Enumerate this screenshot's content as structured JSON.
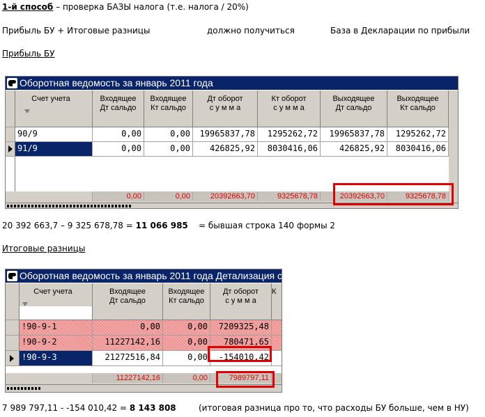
{
  "heading": {
    "method": "1-й способ",
    "rest": " – проверка БАЗЫ налога  (т.е. налога / 20%)"
  },
  "formula_row": {
    "left": "Прибыль БУ   +  Итоговые разницы",
    "middle": "должно получиться",
    "right": "База в  Декларации по прибыли"
  },
  "section1_label": "Прибыль БУ",
  "window1": {
    "title": "Оборотная ведомость за январь 2011 года",
    "headers": [
      [
        "Счет учета",
        ""
      ],
      [
        "Входящее",
        "Дт сальдо"
      ],
      [
        "Входящее",
        "Кт сальдо"
      ],
      [
        "Дт оборот",
        "с у м м а"
      ],
      [
        "Кт оборот",
        "с у м м а"
      ],
      [
        "Выходящее",
        "Дт сальдо"
      ],
      [
        "Выходящее",
        "Кт сальдо"
      ]
    ],
    "rows": [
      [
        "90/9",
        "0,00",
        "0,00",
        "19965837,78",
        "1295262,72",
        "19965837,78",
        "1295262,72"
      ],
      [
        "91/9",
        "0,00",
        "0,00",
        "426825,92",
        "8030416,06",
        "426825,92",
        "8030416,06"
      ]
    ],
    "totals": [
      "0,00",
      "0,00",
      "20392663,70",
      "9325678,78",
      "20392663,70",
      "9325678,78"
    ]
  },
  "calc1": {
    "expr": "20 392 663,7 – 9 325 678,78 = ",
    "result": "11 066 985",
    "note": "= бывшая строка 140  формы 2"
  },
  "section2_label": "Итоговые  разницы",
  "window2": {
    "title": "Оборотная ведомость за январь 2011 года Детализация с",
    "headers": [
      [
        "Счет учета",
        ""
      ],
      [
        "Входящее",
        "Дт сальдо"
      ],
      [
        "Входящее",
        "Кт сальдо"
      ],
      [
        "Дт оборот",
        "с у м м а"
      ],
      [
        "К",
        ""
      ]
    ],
    "rows": [
      [
        "!90-9-1",
        "0,00",
        "0,00",
        "7209325,48"
      ],
      [
        "!90-9-2",
        "11227142,16",
        "0,00",
        "780471,65"
      ],
      [
        "!90-9-3",
        "21272516,84",
        "0,00",
        "-154010,42"
      ]
    ],
    "totals": [
      "11227142,16",
      "0,00",
      "7989797,11"
    ]
  },
  "calc2": {
    "expr": "7 989 797,11  -  -154 010,42 = ",
    "result": "8 143 808",
    "note": "(итоговая разница про то, что расходы БУ больше, чем в НУ)"
  },
  "colors": {
    "titlebar": "#0a246a",
    "highlight_red": "#e00000",
    "grid_face": "#d4d0c8",
    "error_row": "#ee9090"
  },
  "icons": [
    "app-icon",
    "row-pointer-icon",
    "sort-arrow-icon"
  ]
}
